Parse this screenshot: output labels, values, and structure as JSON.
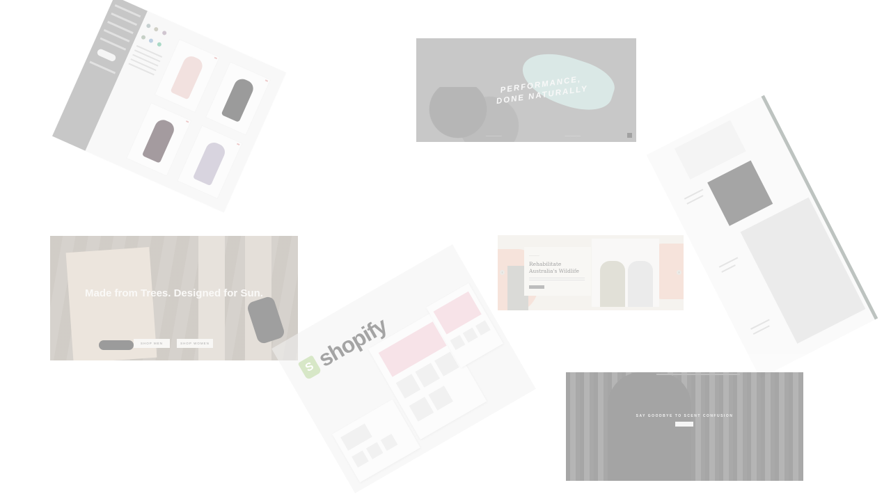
{
  "cards": {
    "dresses": {
      "badges": [
        "",
        "",
        "",
        ""
      ]
    },
    "performance": {
      "headline_line1": "PERFORMANCE,",
      "headline_line2": "DONE NATURALLY"
    },
    "trees": {
      "headline": "Made from Trees. Designed for Sun.",
      "subheadline": "",
      "buttons": [
        "SHOP MEN",
        "SHOP WOMEN"
      ]
    },
    "shopify": {
      "logo_text": "shopify",
      "logo_glyph": "S"
    },
    "wildlife": {
      "title": "Rehabilitate Australia's Wildlife"
    },
    "scent": {
      "tagline": "SAY GOODBYE TO SCENT CONFUSION"
    }
  },
  "colors": {
    "background": "#ffffff",
    "placeholder_gray": "#9c9c9c",
    "shopify_green": "#b8d59a",
    "accent_pink": "#f0cdbf"
  }
}
